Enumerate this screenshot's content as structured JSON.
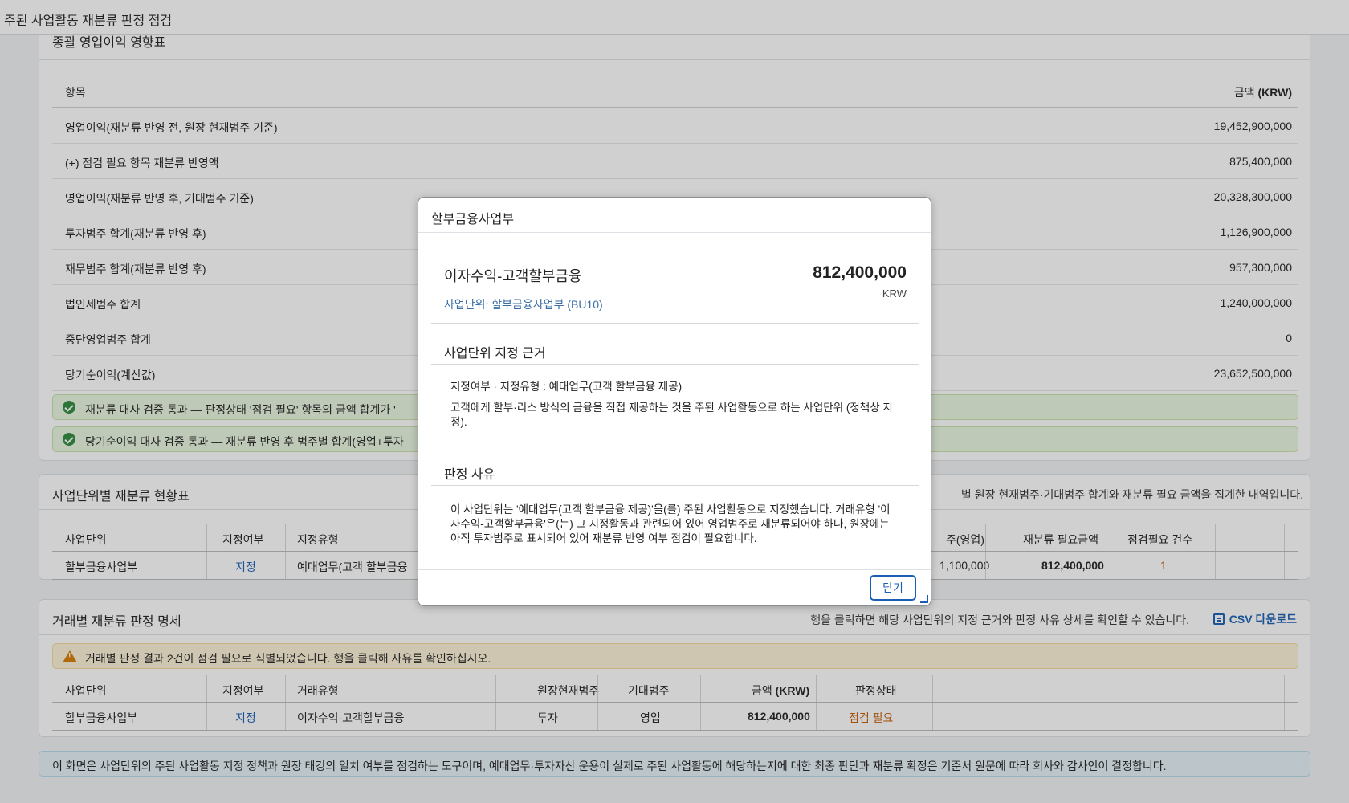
{
  "app": {
    "title": "주된 사업활동 재분류 판정 점검"
  },
  "summary_panel": {
    "title": "종괄 영업이익 영향표",
    "header": {
      "item": "항목",
      "amount_prefix": "금액 ",
      "amount_unit": "(KRW)"
    },
    "rows": [
      {
        "label": "영업이익(재분류 반영 전, 원장 현재범주 기준)",
        "value": "19,452,900,000"
      },
      {
        "label": "(+) 점검 필요 항목 재분류 반영액",
        "value": "875,400,000"
      },
      {
        "label": "영업이익(재분류 반영 후, 기대범주 기준)",
        "value": "20,328,300,000"
      },
      {
        "label": "투자범주 합계(재분류 반영 후)",
        "value": "1,126,900,000"
      },
      {
        "label": "재무범주 합계(재분류 반영 후)",
        "value": "957,300,000"
      },
      {
        "label": "법인세범주 합계",
        "value": "1,240,000,000"
      },
      {
        "label": "중단영업범주 합계",
        "value": "0"
      },
      {
        "label": "당기순이익(계산값)",
        "value": "23,652,500,000"
      }
    ],
    "checks": [
      "재분류 대사 검증 통과 — 판정상태 '점검 필요' 항목의 금액 합계가 '",
      "당기순이익 대사 검증 통과 — 재분류 반영 후 범주별 합계(영업+투자"
    ]
  },
  "bu_panel": {
    "title": "사업단위별 재분류 현황표",
    "desc": "별 원장 현재범주·기대범주 합계와 재분류 필요 금액을 집계한 내역입니다.",
    "headers": {
      "unit": "사업단위",
      "designated": "지정여부",
      "type": "지정유형",
      "expected_op": "주(영업)",
      "reclass_amount": "재분류 필요금액",
      "check_count": "점검필요 건수"
    },
    "rows": [
      {
        "unit": "할부금융사업부",
        "designated": "지정",
        "type": "예대업무(고객 할부금융",
        "expected_op": "1,100,000",
        "reclass_amount": "812,400,000",
        "check_count": "1"
      }
    ]
  },
  "tx_panel": {
    "title": "거래별 재분류 판정 명세",
    "desc": "행을 클릭하면 해당 사업단위의 지정 근거와 판정 사유 상세를 확인할 수 있습니다.",
    "csv_label": "CSV 다운로드",
    "csv_icon": "download-icon",
    "warning": "거래별 판정 결과 2건이 점검 필요로 식별되었습니다. 행을 클릭해 사유를 확인하십시오.",
    "headers": {
      "unit": "사업단위",
      "designated": "지정여부",
      "tx_type": "거래유형",
      "current_cat": "원장현재범주",
      "expected_cat": "기대범주",
      "amount_prefix": "금액 ",
      "amount_unit": "(KRW)",
      "status": "판정상태"
    },
    "rows": [
      {
        "unit": "할부금융사업부",
        "designated": "지정",
        "tx_type": "이자수익-고객할부금융",
        "current_cat": "투자",
        "expected_cat": "영업",
        "amount": "812,400,000",
        "status": "점검 필요"
      }
    ]
  },
  "notice": "이 화면은 사업단위의 주된 사업활동 지정 정책과 원장 태깅의 일치 여부를 점검하는 도구이며, 예대업무·투자자산 운용이 실제로 주된 사업활동에 해당하는지에 대한 최종 판단과 재분류 확정은 기준서 원문에 따라 회사와 감사인이 결정합니다.",
  "modal": {
    "title": "할부금융사업부",
    "tx_name": "이자수익-고객할부금융",
    "amount": "812,400,000",
    "currency": "KRW",
    "unit_line": "사업단위: 할부금융사업부 (BU10)",
    "basis_title": "사업단위 지정 근거",
    "basis_line1": "지정여부 · 지정유형 : 예대업무(고객 할부금융 제공)",
    "basis_line2": "고객에게 할부·리스 방식의 금융을 직접 제공하는 것을 주된 사업활동으로 하는 사업단위 (정책상 지정).",
    "reason_title": "판정 사유",
    "reason_text": "이 사업단위는 '예대업무(고객 할부금융 제공)'을(를) 주된 사업활동으로 지정했습니다. 거래유형 '이자수익-고객할부금융'은(는) 그 지정활동과 관련되어 있어 영업범주로 재분류되어야 하나, 원장에는 아직 투자범주로 표시되어 있어 재분류 반영 여부 점검이 필요합니다.",
    "close_label": "닫기"
  },
  "colors": {
    "accent": "#1a5fb4",
    "ok": "#2f8a3c",
    "warn": "#d97c00",
    "status_warn": "#c45a00"
  }
}
